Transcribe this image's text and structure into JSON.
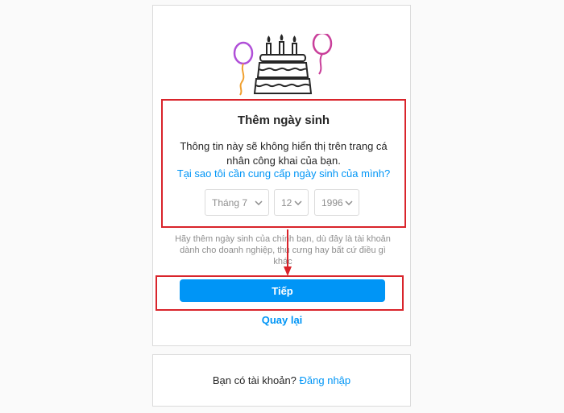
{
  "signup": {
    "title": "Thêm ngày sinh",
    "description": "Thông tin này sẽ không hiển thị trên trang cá nhân công khai của bạn.",
    "why_link": "Tại sao tôi cần cung cấp ngày sinh của mình?",
    "birthday": {
      "month": "Tháng 7",
      "day": "12",
      "year": "1996"
    },
    "hint": "Hãy thêm ngày sinh của chính bạn, dù đây là tài khoản dành cho doanh nghiệp, thú cưng hay bất cứ điều gì khác",
    "next_button": "Tiếp",
    "back_link": "Quay lại"
  },
  "login_prompt": {
    "text": "Bạn có tài khoản?",
    "link": "Đăng nhập"
  },
  "colors": {
    "accent": "#0095f6",
    "annotation": "#d9242b",
    "balloon_left": "#b04fd8",
    "balloon_right": "#c93f9a"
  },
  "icons": [
    "birthday-cake-icon",
    "balloon-icon",
    "chevron-down-icon",
    "annotation-arrow-icon"
  ]
}
